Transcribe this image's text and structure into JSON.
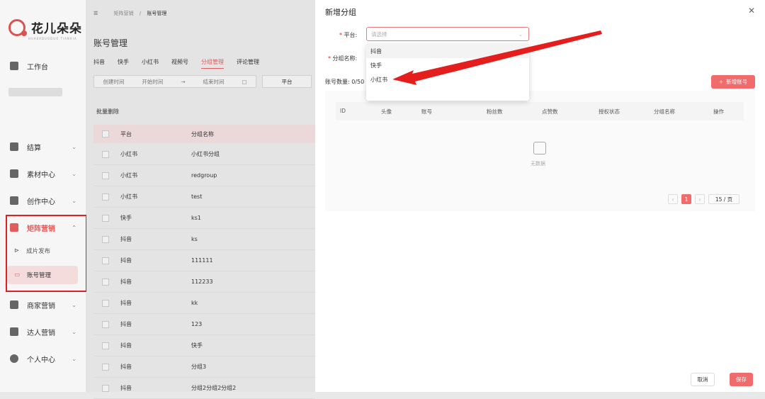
{
  "logo": {
    "name": "花儿朵朵",
    "subtitle": "HUAERDUODUO TIANXIA"
  },
  "sidebar": {
    "items": [
      {
        "label": "工作台"
      },
      {
        "label": "结算"
      },
      {
        "label": "素材中心"
      },
      {
        "label": "创作中心"
      },
      {
        "label": "矩阵营销"
      },
      {
        "label": "商家营销"
      },
      {
        "label": "达人营销"
      },
      {
        "label": "个人中心"
      }
    ],
    "sub_items": [
      {
        "label": "成片发布"
      },
      {
        "label": "账号管理"
      }
    ]
  },
  "breadcrumb": {
    "parent": "矩阵营销",
    "sep": "/",
    "current": "账号管理"
  },
  "page_title": "账号管理",
  "tabs": [
    "抖音",
    "快手",
    "小红书",
    "视频号",
    "分组管理",
    "评论管理"
  ],
  "filter": {
    "start_label": "创建时间",
    "start_placeholder": "开始时间",
    "sep": "→",
    "end_placeholder": "结束时间",
    "platform": "平台"
  },
  "batch_delete": "批量删除",
  "table": {
    "headers": [
      "平台",
      "分组名称"
    ],
    "rows": [
      [
        "小红书",
        "小红书分组"
      ],
      [
        "小红书",
        "redgroup"
      ],
      [
        "小红书",
        "test"
      ],
      [
        "快手",
        "ks1"
      ],
      [
        "抖音",
        "ks"
      ],
      [
        "抖音",
        "111111"
      ],
      [
        "抖音",
        "112233"
      ],
      [
        "抖音",
        "kk"
      ],
      [
        "抖音",
        "123"
      ],
      [
        "抖音",
        "快手"
      ],
      [
        "抖音",
        "分组3"
      ],
      [
        "抖音",
        "分组2分组2分组2"
      ]
    ]
  },
  "drawer": {
    "title": "新增分组",
    "platform_label": "平台:",
    "platform_placeholder": "请选择",
    "group_label": "分组名称:",
    "options": [
      "抖音",
      "快手",
      "小红书"
    ],
    "account_count": "账号数量: 0/50",
    "add_account": "新增账号",
    "columns": [
      "ID",
      "头像",
      "账号",
      "粉丝数",
      "点赞数",
      "授权状态",
      "分组名称",
      "操作"
    ],
    "empty": "无数据",
    "page": "1",
    "page_size": "15 / 页",
    "cancel": "取消",
    "save": "保存"
  },
  "colors": {
    "accent": "#f06b6b",
    "highlight_border": "#e02020"
  }
}
